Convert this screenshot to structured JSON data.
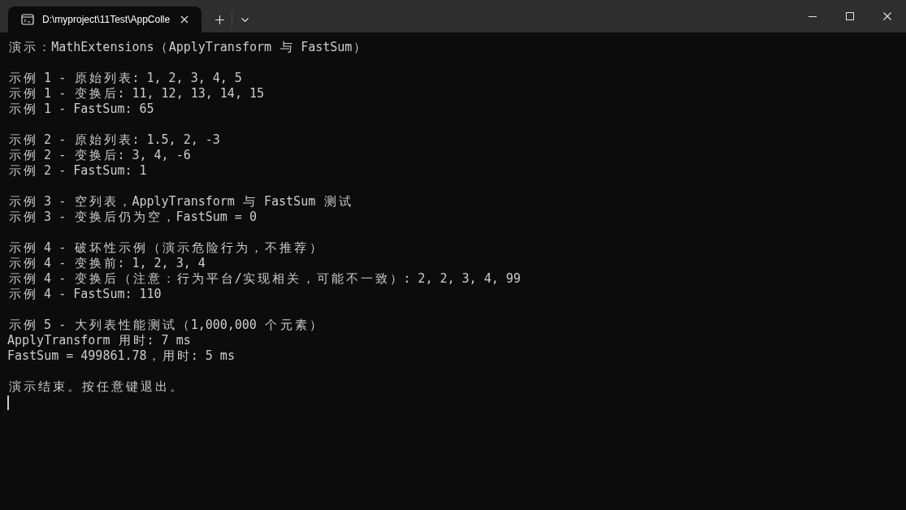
{
  "window": {
    "tabs": [
      {
        "title": "D:\\myproject\\11Test\\AppColle",
        "selected": true
      }
    ]
  },
  "console": {
    "blocks": [
      {
        "lines": [
          "演示：MathExtensions（ApplyTransform 与 FastSum）"
        ]
      },
      {
        "lines": [
          "示例 1 - 原始列表: 1, 2, 3, 4, 5",
          "示例 1 - 变换后: 11, 12, 13, 14, 15",
          "示例 1 - FastSum: 65"
        ]
      },
      {
        "lines": [
          "示例 2 - 原始列表: 1.5, 2, -3",
          "示例 2 - 变换后: 3, 4, -6",
          "示例 2 - FastSum: 1"
        ]
      },
      {
        "lines": [
          "示例 3 - 空列表，ApplyTransform 与 FastSum 测试",
          "示例 3 - 变换后仍为空，FastSum = 0"
        ]
      },
      {
        "lines": [
          "示例 4 - 破坏性示例（演示危险行为，不推荐）",
          "示例 4 - 变换前: 1, 2, 3, 4",
          "示例 4 - 变换后（注意：行为平台/实现相关，可能不一致）: 2, 2, 3, 4, 99",
          "示例 4 - FastSum: 110"
        ]
      },
      {
        "lines": [
          "示例 5 - 大列表性能测试（1,000,000 个元素）",
          "ApplyTransform 用时: 7 ms",
          "FastSum = 499861.78，用时: 5 ms"
        ]
      },
      {
        "lines": [
          "演示结束。按任意键退出。"
        ]
      }
    ]
  }
}
